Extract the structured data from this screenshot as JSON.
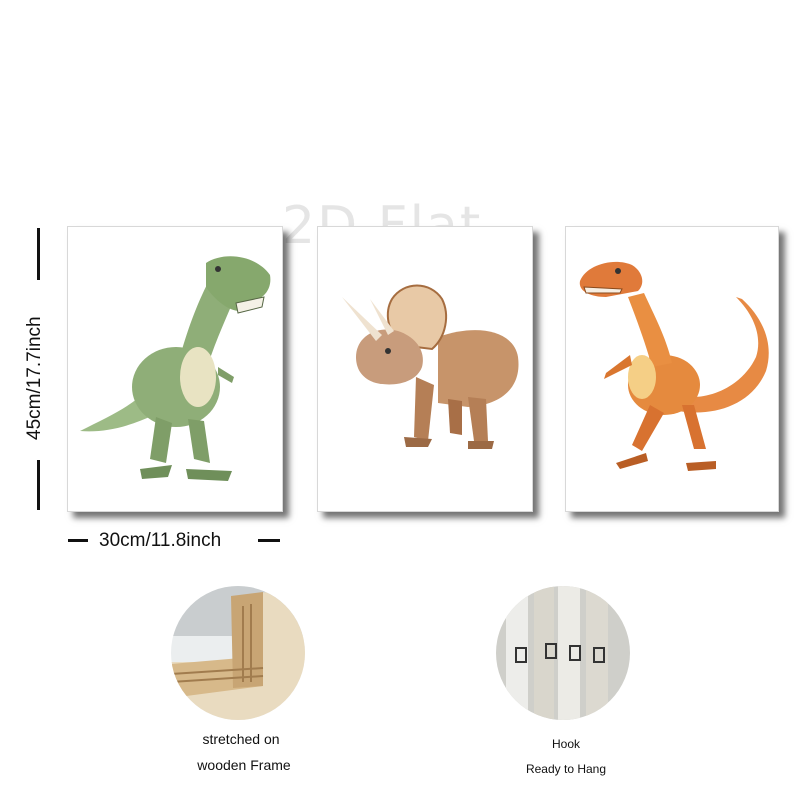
{
  "watermark": "2D Flat",
  "dimensions": {
    "height_label": "45cm/17.7inch",
    "width_label": "30cm/11.8inch"
  },
  "prints": [
    {
      "name": "t-rex-print",
      "color": "#8fae78"
    },
    {
      "name": "triceratops-print",
      "color": "#c7946a"
    },
    {
      "name": "velociraptor-print",
      "color": "#e07a3a"
    }
  ],
  "features": {
    "frame": {
      "line1": "stretched on",
      "line2": "wooden Frame"
    },
    "hook": {
      "line1": "Hook",
      "line2": "Ready to Hang"
    }
  }
}
